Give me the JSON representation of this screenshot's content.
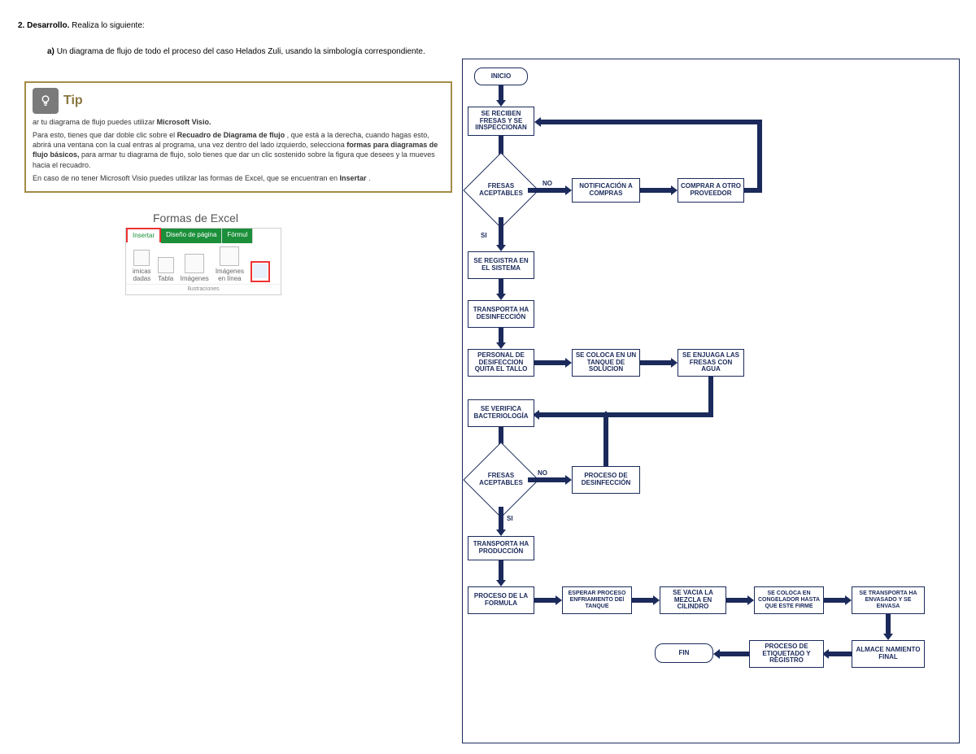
{
  "header": {
    "num": "2.",
    "title": "Desarrollo.",
    "tail": "Realiza lo siguiente:"
  },
  "question": {
    "label": "a)",
    "text": "Un diagrama de flujo de todo el proceso del caso Helados Zuli, usando la simbología correspondiente."
  },
  "tip": {
    "title": "Tip",
    "line1a": "ar tu diagrama de flujo puedes utilizar ",
    "line1b": "Microsoft Visio.",
    "line2a": "Para esto, tienes que dar doble clic sobre el ",
    "line2b": "Recuadro de Diagrama de flujo",
    "line2c": ", que está a la derecha, cuando hagas esto, abrirá una ventana con la cual entras al programa, una vez dentro del lado izquierdo, selecciona ",
    "line2d": "formas para diagramas de flujo básicos,",
    "line2e": " para armar tu diagrama de flujo, solo tienes que dar un clic sostenido sobre la figura que desees y la mueves hacia el recuadro.",
    "line3a": "En caso de no tener Microsoft Visio puedes utilizar las formas de Excel, que se encuentran en ",
    "line3b": "Insertar",
    "line3c": "."
  },
  "ribbon": {
    "caption": "Formas de Excel",
    "tab_insert": "Insertar",
    "tab_design": "Diseño de página",
    "tab_form": "Fórmul",
    "btn_dyn1": "imicas",
    "btn_dyn2": "dadas",
    "btn_tabla": "Tabla",
    "btn_img": "Imágenes",
    "btn_imgol1": "Imágenes",
    "btn_imgol2": "en línea",
    "group": "Ilustraciones"
  },
  "labels": {
    "no": "NO",
    "si": "SI"
  },
  "nodes": {
    "inicio": "INICIO",
    "reciben": "SE RECIBEN FRESAS Y SE IINSPECCIONAN",
    "dec1": "FRESAS ACEPTABLES",
    "notif": "NOTIFICACIÓN A COMPRAS",
    "comprar": "COMPRAR A OTRO PROVEEDOR",
    "registra": "SE REGISTRA EN  EL SISTEMA",
    "trans1": "TRANSPORTA HA DESINFECCIÓN",
    "personal": "PERSONAL DE DESIFECCION QUITA EL TALLO",
    "coloca_sol": "SE COLOCA EN UN TANQUE DE SOLUCION",
    "enjuaga": "SE ENJUAGA LAS FRESAS CON AGUA",
    "verif": "SE VERIFICA BACTERIOLOGÍA",
    "dec2": "FRESAS ACEPTABLES",
    "procdes": "PROCESO DE DESINFECCIÓN",
    "trans2": "TRANSPORTA HA PRODUCCIÓN",
    "formula": "PROCESO DE LA FORMULA",
    "esperar": "ESPERAR PROCESO ENFRIAMIENTO DEl TANQUE",
    "vacia": "SE VACIA LA MEZCLA EN CILINDRO",
    "congel": "SE COLOCA EN CONGELADOR HASTA QUE ESTE FIRME",
    "transp3": "SE TRANSPORTA HA ENVASADO Y SE ENVASA",
    "almacen": "ALMACE NAMIENTO FINAL",
    "etiq": "PROCESO DE ETIQUETADO Y REGISTRO",
    "fin": "FIN"
  }
}
